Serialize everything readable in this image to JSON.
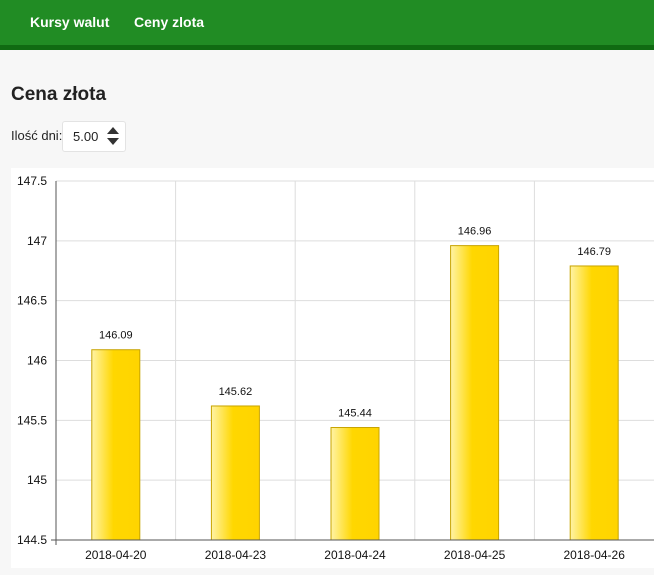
{
  "nav": {
    "items": [
      {
        "label": "Kursy walut"
      },
      {
        "label": "Ceny zlota"
      }
    ]
  },
  "page": {
    "title": "Cena złota"
  },
  "controls": {
    "days_label": "Ilość dni:",
    "days_value": "5.00"
  },
  "colors": {
    "navbar": "#218c24",
    "navbar_border": "#106b12",
    "bar_fill": "#ffd700",
    "bar_stroke": "#c8a400",
    "grid": "#dddddd"
  },
  "chart_data": {
    "type": "bar",
    "categories": [
      "2018-04-20",
      "2018-04-23",
      "2018-04-24",
      "2018-04-25",
      "2018-04-26"
    ],
    "values": [
      146.09,
      145.62,
      145.44,
      146.96,
      146.79
    ],
    "value_labels": [
      "146.09",
      "145.62",
      "145.44",
      "146.96",
      "146.79"
    ],
    "yticks": [
      144.5,
      145,
      145.5,
      146,
      146.5,
      147,
      147.5
    ],
    "ytick_labels": [
      "144.5",
      "145",
      "145.5",
      "146",
      "146.5",
      "147",
      "147.5"
    ],
    "ylim": [
      144.5,
      147.5
    ],
    "grid": true,
    "legend": "none"
  }
}
